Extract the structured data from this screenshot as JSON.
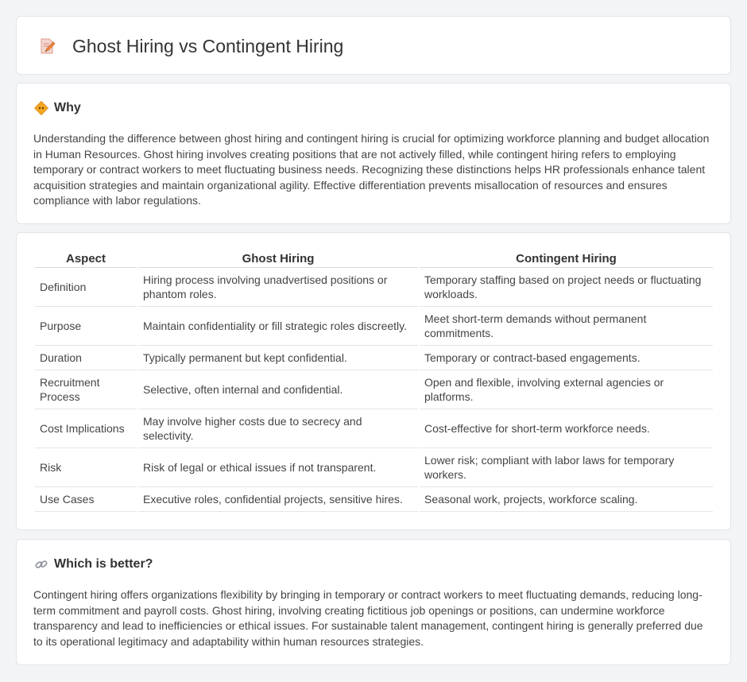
{
  "header": {
    "title": "Ghost Hiring vs Contingent Hiring",
    "icon": "document-pen-icon"
  },
  "why": {
    "heading": "Why",
    "icon": "diamond-sign-icon",
    "text": "Understanding the difference between ghost hiring and contingent hiring is crucial for optimizing workforce planning and budget allocation in Human Resources. Ghost hiring involves creating positions that are not actively filled, while contingent hiring refers to employing temporary or contract workers to meet fluctuating business needs. Recognizing these distinctions helps HR professionals enhance talent acquisition strategies and maintain organizational agility. Effective differentiation prevents misallocation of resources and ensures compliance with labor regulations."
  },
  "comparison": {
    "headers": [
      "Aspect",
      "Ghost Hiring",
      "Contingent Hiring"
    ],
    "rows": [
      {
        "aspect": "Definition",
        "ghost": "Hiring process involving unadvertised positions or phantom roles.",
        "contingent": "Temporary staffing based on project needs or fluctuating workloads."
      },
      {
        "aspect": "Purpose",
        "ghost": "Maintain confidentiality or fill strategic roles discreetly.",
        "contingent": "Meet short-term demands without permanent commitments."
      },
      {
        "aspect": "Duration",
        "ghost": "Typically permanent but kept confidential.",
        "contingent": "Temporary or contract-based engagements."
      },
      {
        "aspect": "Recruitment Process",
        "ghost": "Selective, often internal and confidential.",
        "contingent": "Open and flexible, involving external agencies or platforms."
      },
      {
        "aspect": "Cost Implications",
        "ghost": "May involve higher costs due to secrecy and selectivity.",
        "contingent": "Cost-effective for short-term workforce needs."
      },
      {
        "aspect": "Risk",
        "ghost": "Risk of legal or ethical issues if not transparent.",
        "contingent": "Lower risk; compliant with labor laws for temporary workers."
      },
      {
        "aspect": "Use Cases",
        "ghost": "Executive roles, confidential projects, sensitive hires.",
        "contingent": "Seasonal work, projects, workforce scaling."
      }
    ]
  },
  "better": {
    "heading": "Which is better?",
    "icon": "link-icon",
    "text": "Contingent hiring offers organizations flexibility by bringing in temporary or contract workers to meet fluctuating demands, reducing long-term commitment and payroll costs. Ghost hiring, involving creating fictitious job openings or positions, can undermine workforce transparency and lead to inefficiencies or ethical issues. For sustainable talent management, contingent hiring is generally preferred due to its operational legitimacy and adaptability within human resources strategies."
  }
}
